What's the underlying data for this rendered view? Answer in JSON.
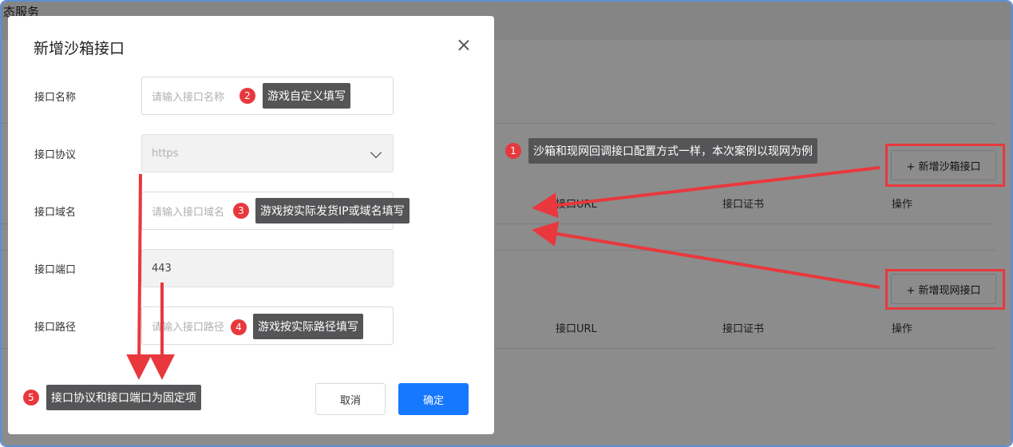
{
  "background": {
    "page_title": "态服务",
    "sections": [
      {
        "button_label": "+ 新增沙箱接口",
        "columns": [
          "接口URL",
          "接口证书",
          "操作"
        ]
      },
      {
        "button_label": "+ 新增现网接口",
        "columns": [
          "接口URL",
          "接口证书",
          "操作"
        ]
      }
    ]
  },
  "dialog": {
    "title": "新增沙箱接口",
    "fields": [
      {
        "label": "接口名称",
        "placeholder": "请输入接口名称",
        "value": ""
      },
      {
        "label": "接口协议",
        "placeholder": "https",
        "value": ""
      },
      {
        "label": "接口域名",
        "placeholder": "请输入接口域名",
        "value": ""
      },
      {
        "label": "接口端口",
        "placeholder": "",
        "value": "443"
      },
      {
        "label": "接口路径",
        "placeholder": "请输入接口路径",
        "value": ""
      }
    ],
    "cancel_label": "取消",
    "confirm_label": "确定"
  },
  "annotations": [
    {
      "number": "1",
      "text": "沙箱和现网回调接口配置方式一样，本次案例以现网为例"
    },
    {
      "number": "2",
      "text": "游戏自定义填写"
    },
    {
      "number": "3",
      "text": "游戏按实际发货IP或域名填写"
    },
    {
      "number": "4",
      "text": "游戏按实际路径填写"
    },
    {
      "number": "5",
      "text": "接口协议和接口端口为固定项"
    }
  ],
  "colors": {
    "annotation_red": "#e8383d",
    "primary_blue": "#1677ff",
    "callout_bg": "#555557"
  }
}
